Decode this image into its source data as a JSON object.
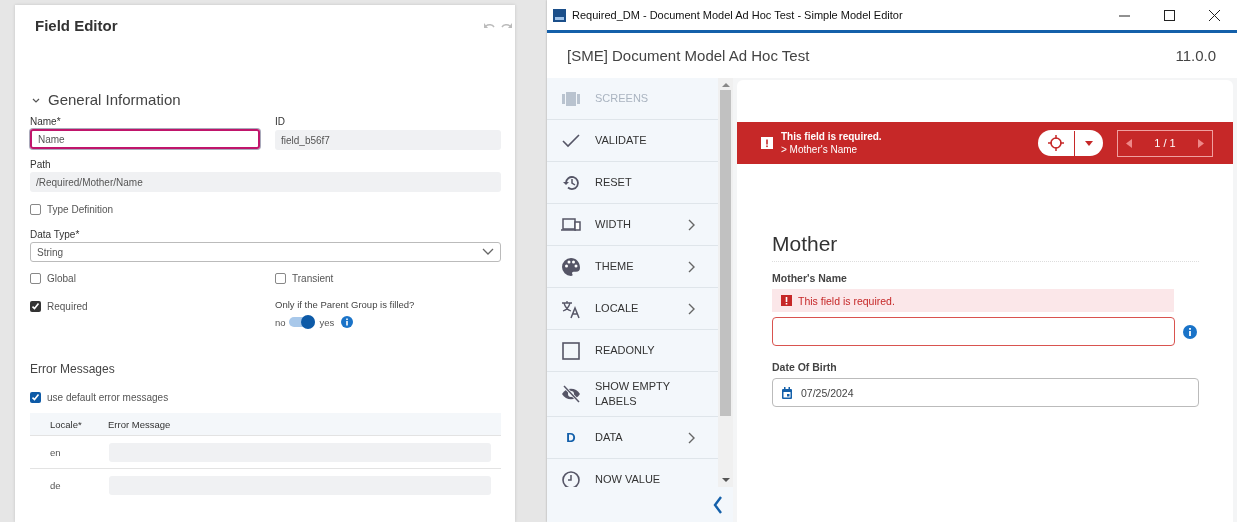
{
  "field_editor": {
    "title": "Field Editor",
    "section": {
      "label": "General Information",
      "expanded": true
    },
    "name": {
      "label": "Name*",
      "value": "Name",
      "focused": true
    },
    "id": {
      "label": "ID",
      "value": "field_b56f7"
    },
    "path": {
      "label": "Path",
      "value": "/Required/Mother/Name"
    },
    "type_definition": {
      "label": "Type Definition",
      "checked": false
    },
    "data_type": {
      "label": "Data Type*",
      "value": "String"
    },
    "global": {
      "label": "Global",
      "checked": false
    },
    "transient": {
      "label": "Transient",
      "checked": false
    },
    "required": {
      "label": "Required",
      "checked": true
    },
    "parent_group": {
      "label": "Only if the Parent Group is filled?",
      "off_label": "no",
      "on_label": "yes",
      "on": true
    },
    "error_messages": {
      "title": "Error Messages",
      "use_default": {
        "label": "use default error messages",
        "checked": true
      },
      "columns": [
        "Locale*",
        "Error Message"
      ],
      "rows": [
        {
          "locale": "en"
        },
        {
          "locale": "de"
        }
      ]
    }
  },
  "app": {
    "window_title": "Required_DM - Document Model Ad Hoc Test - Simple Model Editor",
    "header_title": "[SME] Document Model Ad Hoc Test",
    "version": "11.0.0",
    "sidebar": [
      {
        "label": "SCREENS",
        "kind": "plain",
        "disabled": true
      },
      {
        "label": "VALIDATE",
        "kind": "plain",
        "disabled": false
      },
      {
        "label": "RESET",
        "kind": "plain",
        "disabled": false
      },
      {
        "label": "WIDTH",
        "kind": "submenu",
        "disabled": false
      },
      {
        "label": "THEME",
        "kind": "submenu",
        "disabled": false
      },
      {
        "label": "LOCALE",
        "kind": "submenu",
        "disabled": false
      },
      {
        "label": "READONLY",
        "kind": "plain",
        "disabled": false
      },
      {
        "label": "SHOW EMPTY LABELS",
        "kind": "plain",
        "disabled": false
      },
      {
        "label": "DATA",
        "kind": "submenu",
        "disabled": false,
        "icon_text": "D"
      },
      {
        "label": "NOW VALUE",
        "kind": "plain",
        "disabled": false
      }
    ],
    "error_banner": {
      "message": "This field is required.",
      "target": "> Mother's Name",
      "counter": "1 / 1"
    },
    "form": {
      "heading": "Mother",
      "fields": [
        {
          "kind": "text",
          "label": "Mother's Name",
          "error": "This field is required.",
          "invalid": true
        },
        {
          "kind": "date",
          "label": "Date Of Birth",
          "value": "07/25/2024",
          "invalid": false
        }
      ]
    }
  }
}
